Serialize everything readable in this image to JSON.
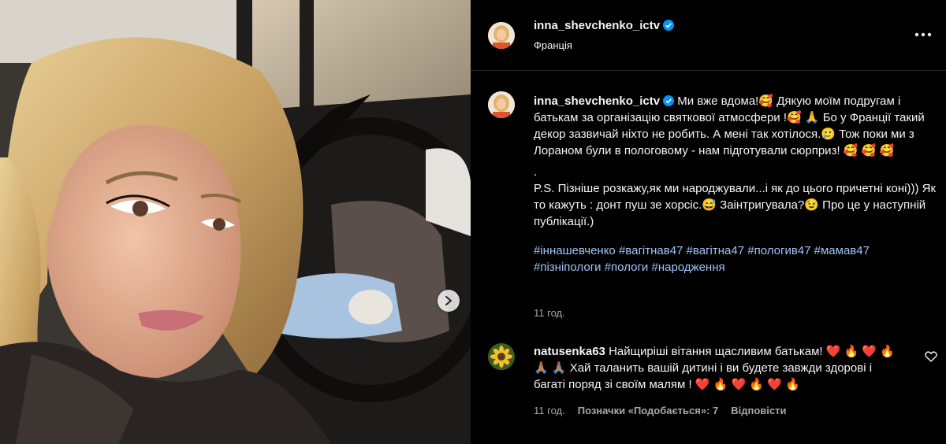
{
  "post": {
    "username": "inna_shevchenko_ictv",
    "location": "Франція",
    "caption_lines": [
      "Ми вже вдома!🥰 Дякую моїм подругам і батькам за організацію святкової атмосфери !🥰 🙏 Бо у Франції такий декор зазвичай ніхто не робить. А мені так хотілося.🥲 Тож поки ми з Лораном були в пологовому - нам підготували сюрприз! 🥰 🥰 🥰",
      ".",
      "P.S. Пізніше розкажу,як ми народжували...і як до цього причетні коні))) Як то кажуть : донт пуш зе хорсіс.😅 Заінтригувала?😉 Про це у наступній публікації.)"
    ],
    "hashtags": [
      "#іннашевченко",
      "#вагітнав47",
      "#вагітна47",
      "#пологив47",
      "#мамав47",
      "#пізніпологи",
      "#пологи",
      "#народження"
    ],
    "time": "11 год."
  },
  "comment": {
    "username": "natusenka63",
    "text": "Найщиріші вітання щасливим батькам! ❤️ 🔥 ❤️ 🔥 🙏🏽 🙏🏽 Хай таланить вашій дитині і ви будете завжди здорові і багаті поряд зі своїм малям ! ❤️ 🔥 ❤️ 🔥 ❤️ 🔥",
    "time": "11 год.",
    "likes_label": "Позначки «Подобається»: 7",
    "reply_label": "Відповісти"
  },
  "icons": {
    "more": "more-horizontal-icon",
    "verified": "verified-badge-icon",
    "next": "chevron-right-icon",
    "like": "heart-outline-icon"
  },
  "colors": {
    "background": "#000000",
    "hashtag": "#a0c4f8",
    "verified": "#0095f6",
    "muted": "#a8a8a8"
  }
}
